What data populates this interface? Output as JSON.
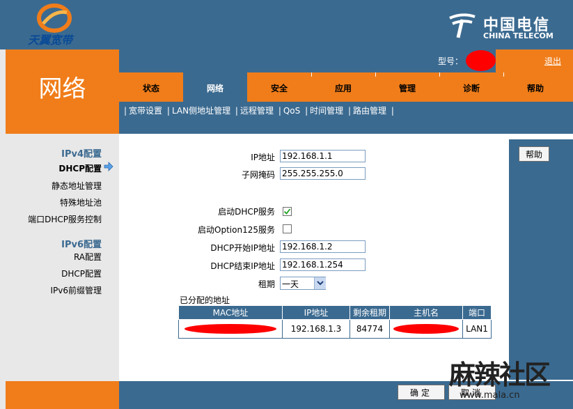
{
  "header": {
    "brand_text": "天翼宽带",
    "telecom_cn": "中国电信",
    "telecom_en": "CHINA TELECOM",
    "model_label": "型号：",
    "logout": "退出"
  },
  "page_title": "网络",
  "tabs": [
    {
      "label": "状态",
      "active": false
    },
    {
      "label": "网络",
      "active": true
    },
    {
      "label": "安全",
      "active": false
    },
    {
      "label": "应用",
      "active": false
    },
    {
      "label": "管理",
      "active": false
    },
    {
      "label": "诊断",
      "active": false
    },
    {
      "label": "帮助",
      "active": false
    }
  ],
  "subnav": [
    "宽带设置",
    "LAN侧地址管理",
    "远程管理",
    "QoS",
    "时间管理",
    "路由管理"
  ],
  "sidebar": {
    "ipv4_heading": "IPv4配置",
    "ipv4_items": [
      "DHCP配置",
      "静态地址管理",
      "特殊地址池",
      "端口DHCP服务控制"
    ],
    "ipv6_heading": "IPv6配置",
    "ipv6_items": [
      "RA配置",
      "DHCP配置",
      "IPv6前缀管理"
    ]
  },
  "form": {
    "ip_label": "IP地址",
    "ip_value": "192.168.1.1",
    "mask_label": "子网掩码",
    "mask_value": "255.255.255.0",
    "dhcp_enable_label": "启动DHCP服务",
    "dhcp_enable_checked": true,
    "opt125_label": "启动Option125服务",
    "opt125_checked": false,
    "start_label": "DHCP开始IP地址",
    "start_value": "192.168.1.2",
    "end_label": "DHCP结束IP地址",
    "end_value": "192.168.1.254",
    "lease_label": "租期",
    "lease_value": "一天"
  },
  "assigned": {
    "title": "已分配的地址",
    "headers": [
      "MAC地址",
      "IP地址",
      "剩余租期",
      "主机名",
      "端口"
    ],
    "rows": [
      {
        "ip": "192.168.1.3",
        "lease": "84774",
        "port": "LAN1"
      }
    ]
  },
  "buttons": {
    "help": "帮助",
    "confirm": "确定",
    "cancel": "取消"
  },
  "watermark": {
    "text": "麻辣社区",
    "url": "www.mala.cn"
  },
  "colors": {
    "blue": "#3b6a90",
    "orange": "#f07d1a",
    "redaction": "#ff0000"
  }
}
